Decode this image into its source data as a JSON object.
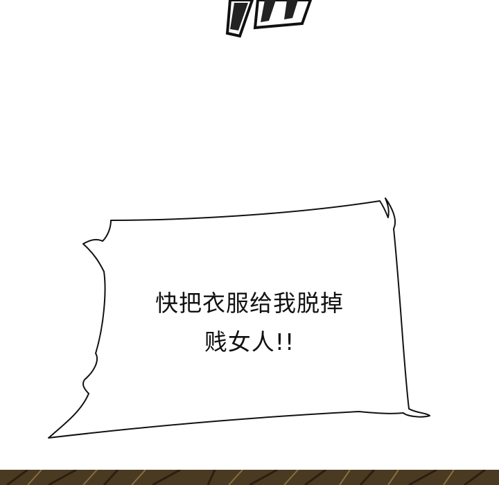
{
  "speech_bubble": {
    "line1": "快把衣服给我脱掉",
    "line2": "贱女人!!"
  },
  "colors": {
    "background": "#ffffff",
    "ink": "#111111",
    "bottom_panel": "#4a3a22"
  }
}
